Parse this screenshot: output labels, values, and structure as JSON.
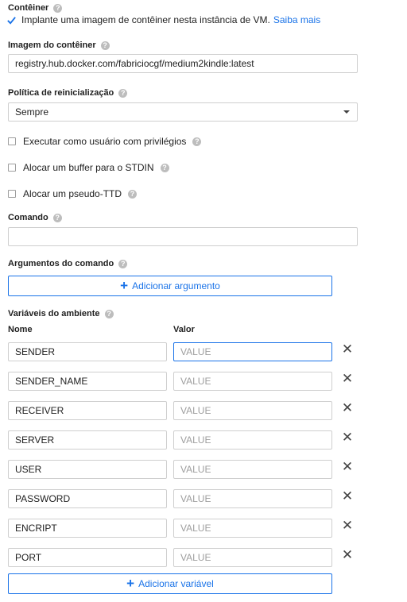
{
  "container": {
    "title": "Contêiner",
    "checkbox_label": "Implante uma imagem de contêiner nesta instância de VM.",
    "learn_more": "Saiba mais",
    "checked": true
  },
  "image": {
    "label": "Imagem do contêiner",
    "value": "registry.hub.docker.com/fabriciocgf/medium2kindle:latest"
  },
  "restart_policy": {
    "label": "Política de reinicialização",
    "selected": "Sempre"
  },
  "options": [
    {
      "label": "Executar como usuário com privilégios",
      "checked": false
    },
    {
      "label": "Alocar um buffer para o STDIN",
      "checked": false
    },
    {
      "label": "Alocar um pseudo-TTD",
      "checked": false
    }
  ],
  "command": {
    "label": "Comando",
    "value": ""
  },
  "arguments": {
    "label": "Argumentos do comando",
    "add_button": "Adicionar argumento"
  },
  "env": {
    "label": "Variáveis do ambiente",
    "name_header": "Nome",
    "value_header": "Valor",
    "value_placeholder": "VALUE",
    "rows": [
      {
        "name": "SENDER"
      },
      {
        "name": "SENDER_NAME"
      },
      {
        "name": "RECEIVER"
      },
      {
        "name": "SERVER"
      },
      {
        "name": "USER"
      },
      {
        "name": "PASSWORD"
      },
      {
        "name": "ENCRIPT"
      },
      {
        "name": "PORT"
      }
    ],
    "add_button": "Adicionar variável"
  },
  "icons": {
    "help": "help-circle-icon",
    "close": "close-icon",
    "plus": "plus-icon",
    "check": "checkmark-icon",
    "dropdown": "dropdown-arrow-icon"
  },
  "colors": {
    "accent": "#1a73e8",
    "help_icon": "#bdbdbd",
    "border": "#cfcfcf"
  }
}
